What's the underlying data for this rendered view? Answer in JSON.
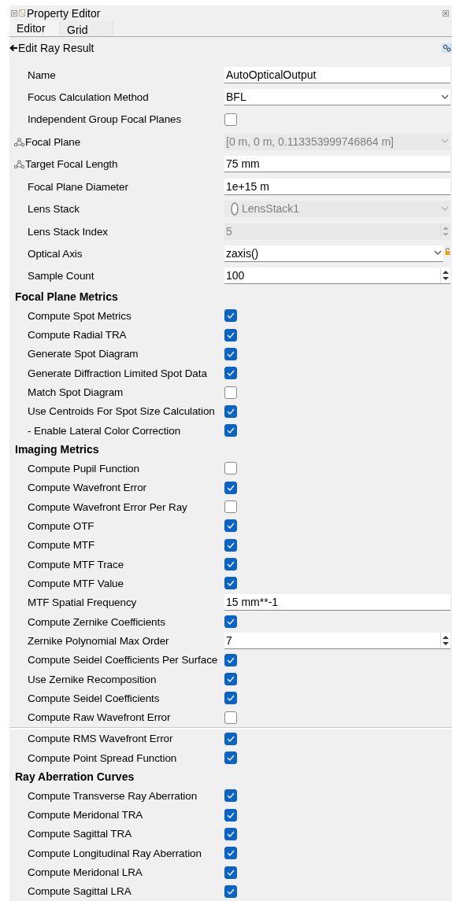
{
  "window": {
    "title": "Property Editor"
  },
  "tabs": [
    {
      "label": "Editor",
      "selected": true
    },
    {
      "label": "Grid",
      "selected": false
    }
  ],
  "header": {
    "title": "Edit Ray Result"
  },
  "properties": [
    {
      "label": "Name",
      "kind": "text",
      "value": "AutoOpticalOutput",
      "disabled": false,
      "linked": false,
      "lock": false
    },
    {
      "label": "Focus Calculation Method",
      "kind": "combo",
      "value": "BFL",
      "disabled": false,
      "linked": false,
      "lock": false
    },
    {
      "label": "Independent Group Focal Planes",
      "kind": "check",
      "checked": false,
      "disabled": false,
      "linked": false,
      "lock": false
    },
    {
      "label": "Focal Plane",
      "kind": "combo",
      "value": "[0 m, 0 m, 0.113353999746864 m]",
      "disabled": true,
      "linked": true,
      "lock": false
    },
    {
      "label": "Target Focal Length",
      "kind": "text",
      "value": "75 mm",
      "disabled": false,
      "linked": true,
      "lock": false
    },
    {
      "label": "Focal Plane Diameter",
      "kind": "text",
      "value": "1e+15 m",
      "disabled": false,
      "linked": false,
      "lock": false
    },
    {
      "label": "Lens Stack",
      "kind": "object",
      "value": "LensStack1",
      "disabled": true,
      "linked": false,
      "lock": false
    },
    {
      "label": "Lens Stack Index",
      "kind": "spin",
      "value": "5",
      "disabled": true,
      "linked": false,
      "lock": false
    },
    {
      "label": "Optical Axis",
      "kind": "combo",
      "value": "zaxis()",
      "disabled": false,
      "linked": false,
      "lock": true
    },
    {
      "label": "Sample Count",
      "kind": "spin",
      "value": "100",
      "disabled": false,
      "linked": false,
      "lock": false
    }
  ],
  "sections": [
    {
      "title": "Focal Plane Metrics",
      "groups": [
        [
          {
            "label": "Compute Spot Metrics",
            "kind": "check",
            "checked": true
          },
          {
            "label": "Compute Radial TRA",
            "kind": "check",
            "checked": true
          },
          {
            "label": "Generate Spot Diagram",
            "kind": "check",
            "checked": true
          },
          {
            "label": "Generate Diffraction Limited Spot Data",
            "kind": "check",
            "checked": true
          },
          {
            "label": "Match Spot Diagram",
            "kind": "check",
            "checked": false
          },
          {
            "label": "Use Centroids For Spot Size Calculation",
            "kind": "check",
            "checked": true
          },
          {
            "label": "- Enable Lateral Color Correction",
            "kind": "check",
            "checked": true
          }
        ]
      ]
    },
    {
      "title": "Imaging Metrics",
      "groups": [
        [
          {
            "label": "Compute Pupil Function",
            "kind": "check",
            "checked": false
          },
          {
            "label": "Compute Wavefront Error",
            "kind": "check",
            "checked": true
          },
          {
            "label": "Compute Wavefront Error Per Ray",
            "kind": "check",
            "checked": false
          },
          {
            "label": "Compute OTF",
            "kind": "check",
            "checked": true
          },
          {
            "label": "Compute MTF",
            "kind": "check",
            "checked": true
          },
          {
            "label": "Compute MTF Trace",
            "kind": "check",
            "checked": true
          },
          {
            "label": "Compute MTF Value",
            "kind": "check",
            "checked": true
          },
          {
            "label": "MTF Spatial Frequency",
            "kind": "text",
            "value": "15 mm**-1"
          },
          {
            "label": "Compute Zernike Coefficients",
            "kind": "check",
            "checked": true
          },
          {
            "label": "Zernike Polynomial Max Order",
            "kind": "spin",
            "value": "7"
          },
          {
            "label": "Compute Seidel Coefficients Per Surface",
            "kind": "check",
            "checked": true
          },
          {
            "label": "Use Zernike Recomposition",
            "kind": "check",
            "checked": true
          },
          {
            "label": "Compute Seidel Coefficients",
            "kind": "check",
            "checked": true
          },
          {
            "label": "Compute Raw Wavefront Error",
            "kind": "check",
            "checked": false
          }
        ],
        [
          {
            "label": "Compute RMS Wavefront Error",
            "kind": "check",
            "checked": true
          },
          {
            "label": "Compute Point Spread Function",
            "kind": "check",
            "checked": true
          }
        ]
      ]
    },
    {
      "title": "Ray Aberration Curves",
      "groups": [
        [
          {
            "label": "Compute Transverse Ray Aberration",
            "kind": "check",
            "checked": true
          },
          {
            "label": "Compute Meridonal TRA",
            "kind": "check",
            "checked": true
          },
          {
            "label": "Compute Sagittal TRA",
            "kind": "check",
            "checked": true
          },
          {
            "label": "Compute Longitudinal Ray Aberration",
            "kind": "check",
            "checked": true
          },
          {
            "label": "Compute Meridonal LRA",
            "kind": "check",
            "checked": true
          },
          {
            "label": "Compute Sagittal LRA",
            "kind": "check",
            "checked": true
          }
        ]
      ]
    }
  ]
}
